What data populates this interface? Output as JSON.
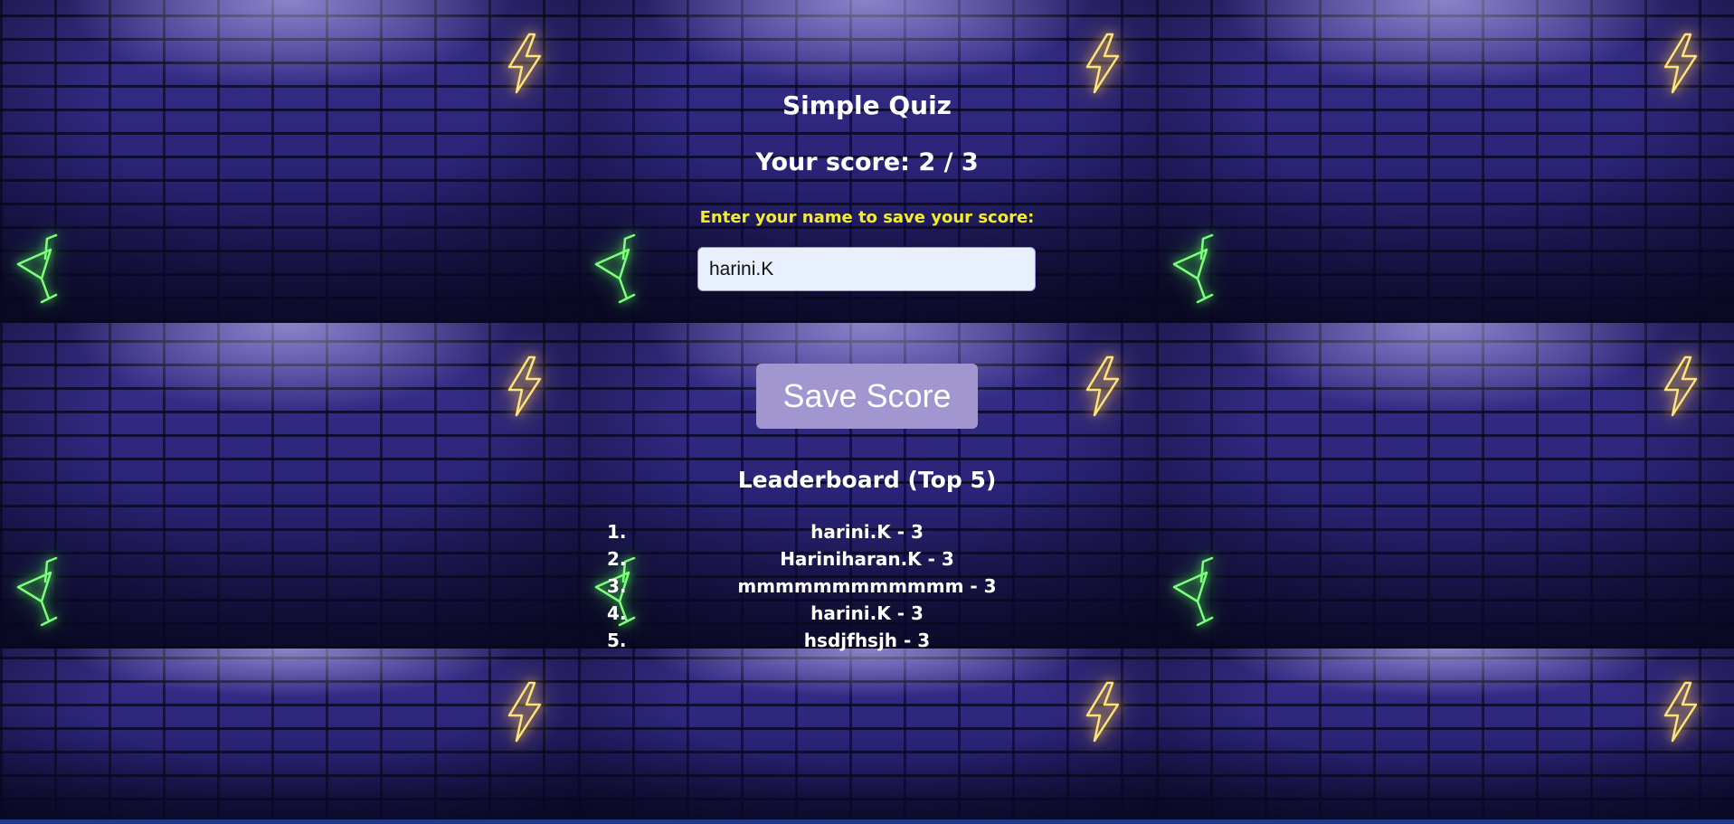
{
  "quiz": {
    "title": "Simple Quiz",
    "score_text": "Your score: 2 / 3",
    "prompt": "Enter your name to save your score:",
    "name_value": "harini.K",
    "save_label": "Save Score"
  },
  "leaderboard": {
    "title": "Leaderboard (Top 5)",
    "entries": [
      {
        "rank": "1.",
        "text": "harini.K - 3"
      },
      {
        "rank": "2.",
        "text": "Hariniharan.K - 3"
      },
      {
        "rank": "3.",
        "text": "mmmmmmmmmmmm - 3"
      },
      {
        "rank": "4.",
        "text": "harini.K - 3"
      },
      {
        "rank": "5.",
        "text": "hsdjfhsjh - 3"
      }
    ]
  },
  "background": {
    "decor_icons": [
      "lightning-bolt-icon",
      "cocktail-glass-icon"
    ],
    "colors": {
      "wall": "#2a2470",
      "bolt_neon": "#ffd65a",
      "glass_neon": "#5aff5a",
      "prompt_text": "#f4ee2a",
      "button": "#a196cf",
      "input_bg": "#e8f0fe"
    }
  }
}
